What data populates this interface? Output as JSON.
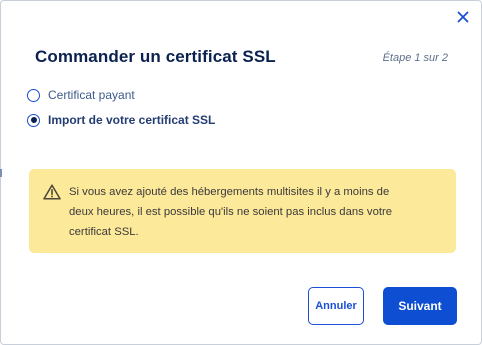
{
  "dialog": {
    "title": "Commander un certificat SSL",
    "step": "Étape 1 sur 2"
  },
  "options": [
    {
      "label": "Certificat payant",
      "selected": false
    },
    {
      "label": "Import de votre certificat SSL",
      "selected": true
    }
  ],
  "warning": {
    "icon": "warning-triangle-icon",
    "line1": "Si vous avez ajouté des hébergements multisites il y a moins de",
    "line2": "deux heures, il est possible qu'ils ne soient pas inclus dans votre",
    "line3": "certificat SSL."
  },
  "buttons": {
    "cancel_label": "Annuler",
    "next_label": "Suivant"
  },
  "colors": {
    "primary": "#0d4ed3",
    "title": "#0b2250",
    "warning_bg": "#fde99a"
  }
}
